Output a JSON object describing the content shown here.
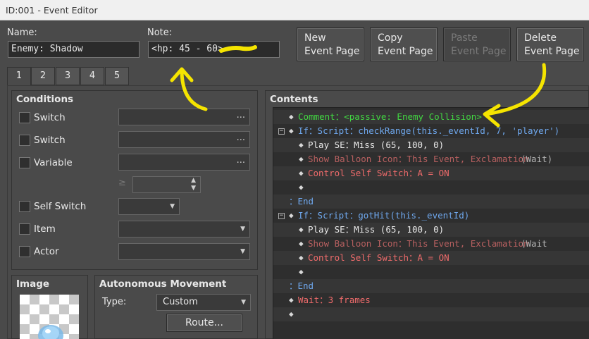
{
  "window": {
    "title": "ID:001 - Event Editor"
  },
  "name": {
    "label": "Name:",
    "value": "Enemy: Shadow"
  },
  "note": {
    "label": "Note:",
    "value": "<hp: 45 - 60>"
  },
  "buttons": {
    "new_page": [
      "New",
      "Event Page"
    ],
    "copy_page": [
      "Copy",
      "Event Page"
    ],
    "paste_page": [
      "Paste",
      "Event Page"
    ],
    "delete_page": [
      "Delete",
      "Event Page"
    ]
  },
  "tabs": [
    "1",
    "2",
    "3",
    "4",
    "5"
  ],
  "conditions": {
    "title": "Conditions",
    "switch1": "Switch",
    "switch2": "Switch",
    "variable": "Variable",
    "gte": "≥",
    "self_switch": "Self Switch",
    "item": "Item",
    "actor": "Actor",
    "dots": "..."
  },
  "image": {
    "title": "Image"
  },
  "movement": {
    "title": "Autonomous Movement",
    "type_label": "Type:",
    "type_value": "Custom",
    "route_button": "Route..."
  },
  "contents": {
    "title": "Contents",
    "lines": {
      "l1": "Comment：<passive: Enemy Collision>",
      "l2": "If：Script：checkRange(this._eventId, 7, 'player')",
      "l3": "Play SE：Miss (65, 100, 0)",
      "l4a": "Show Balloon Icon：This Event, Exclamation",
      "l4b": "(Wait)",
      "l5": "Control Self Switch：A = ON",
      "l7": "：End",
      "l8": "If：Script：gotHit(this._eventId)",
      "l9": "Play SE：Miss (65, 100, 0)",
      "l10a": "Show Balloon Icon：This Event, Exclamation",
      "l10b": "(Wait",
      "l11": "Control Self Switch：A = ON",
      "l13": "：End",
      "l14": "Wait：3 frames"
    },
    "collapse_symbol": "−",
    "diamond": "◆"
  },
  "colors": {
    "comment": "#42d742",
    "flow": "#6fa8ee",
    "command": "#e8e8e8",
    "switch": "#ef6b6b",
    "annotation": "#f5e400"
  }
}
